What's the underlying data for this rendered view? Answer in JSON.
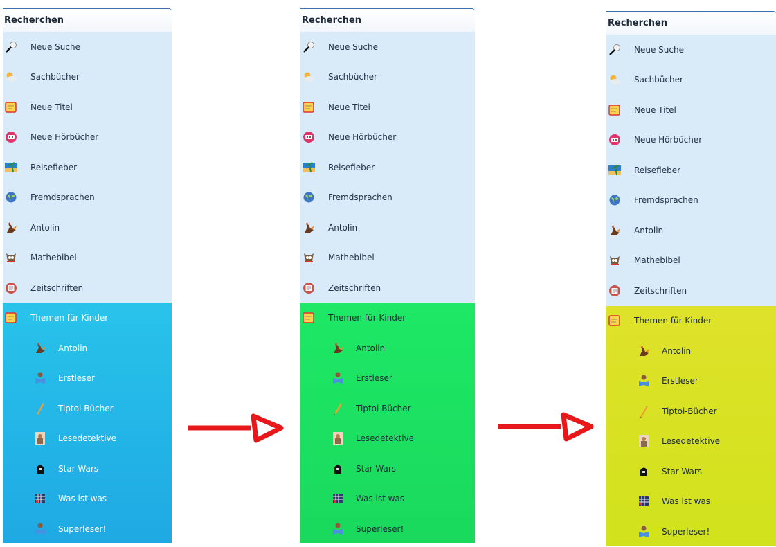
{
  "panels": [
    {
      "header": "Recherchen",
      "theme": "blue"
    },
    {
      "header": "Recherchen",
      "theme": "green"
    },
    {
      "header": "Recherchen",
      "theme": "yellow"
    }
  ],
  "menu": {
    "items": [
      {
        "label": "Neue Suche",
        "icon": "magnifier-icon"
      },
      {
        "label": "Sachbücher",
        "icon": "cloud-sun-icon"
      },
      {
        "label": "Neue Titel",
        "icon": "notepad-icon"
      },
      {
        "label": "Neue Hörbücher",
        "icon": "cassette-icon"
      },
      {
        "label": "Reisefieber",
        "icon": "beach-icon"
      },
      {
        "label": "Fremdsprachen",
        "icon": "globe-icon"
      },
      {
        "label": "Antolin",
        "icon": "rooster-icon"
      },
      {
        "label": "Mathebibel",
        "icon": "owl-icon"
      },
      {
        "label": "Zeitschriften",
        "icon": "magazine-icon"
      }
    ],
    "themen": {
      "label": "Themen für Kinder",
      "icon": "notepad-icon"
    },
    "sub_items": [
      {
        "label": "Antolin",
        "icon": "rooster-icon"
      },
      {
        "label": "Erstleser",
        "icon": "reader-icon"
      },
      {
        "label": "Tiptoi-Bücher",
        "icon": "pen-icon"
      },
      {
        "label": "Lesedetektive",
        "icon": "detective-icon"
      },
      {
        "label": "Star Wars",
        "icon": "robot-icon"
      },
      {
        "label": "Was ist was",
        "icon": "book-grid-icon"
      },
      {
        "label": "Superleser!",
        "icon": "reader-icon"
      }
    ]
  },
  "colors": {
    "light_bg": "#d9eaf9",
    "blue_top": "#28c3ea",
    "blue_bottom": "#1fa9e4",
    "green_top": "#1ee866",
    "green_bottom": "#1ad95d",
    "yellow_top": "#dfe22a",
    "yellow_bottom": "#d1e21c",
    "arrow": "#e8181a"
  }
}
